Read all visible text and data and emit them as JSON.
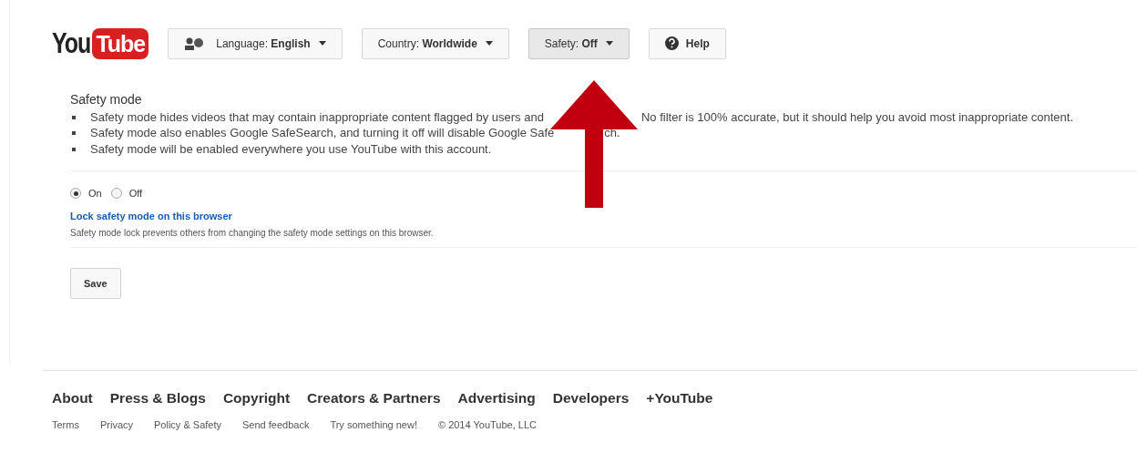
{
  "header": {
    "logo": {
      "word": "You",
      "badge": "Tube"
    },
    "buttons": [
      {
        "kind": "language",
        "label": "Language:",
        "value": "English",
        "pressed": false
      },
      {
        "kind": "country",
        "label": "Country:",
        "value": "Worldwide",
        "pressed": false
      },
      {
        "kind": "safety",
        "label": "Safety:",
        "value": "Off",
        "pressed": true
      },
      {
        "kind": "help",
        "label": "Help",
        "pressed": false
      }
    ]
  },
  "safety_mode": {
    "title": "Safety mode",
    "bullets": [
      {
        "segments": [
          "Safety mode hides videos that may contain inappropriate content flagged by users and",
          "No filter is 100% accurate, but it should help you avoid most inappropriate content."
        ]
      },
      {
        "segments": [
          "Safety mode also enables Google SafeSearch, and turning it off will disable Google Safe",
          "ch."
        ]
      },
      {
        "segments": [
          "Safety mode will be enabled everywhere you use YouTube with this account."
        ]
      }
    ],
    "options": [
      {
        "label": "On",
        "selected": true
      },
      {
        "label": "Off",
        "selected": false
      }
    ],
    "lock_link": "Lock safety mode on this browser",
    "lock_description": "Safety mode lock prevents others from changing the safety mode settings on this browser.",
    "save_button": "Save"
  },
  "footer": {
    "links": [
      "About",
      "Press & Blogs",
      "Copyright",
      "Creators & Partners",
      "Advertising",
      "Developers",
      "+YouTube"
    ],
    "small_links": [
      "Terms",
      "Privacy",
      "Policy & Safety",
      "Send feedback",
      "Try something new!"
    ],
    "copyright": "© 2014 YouTube, LLC"
  }
}
